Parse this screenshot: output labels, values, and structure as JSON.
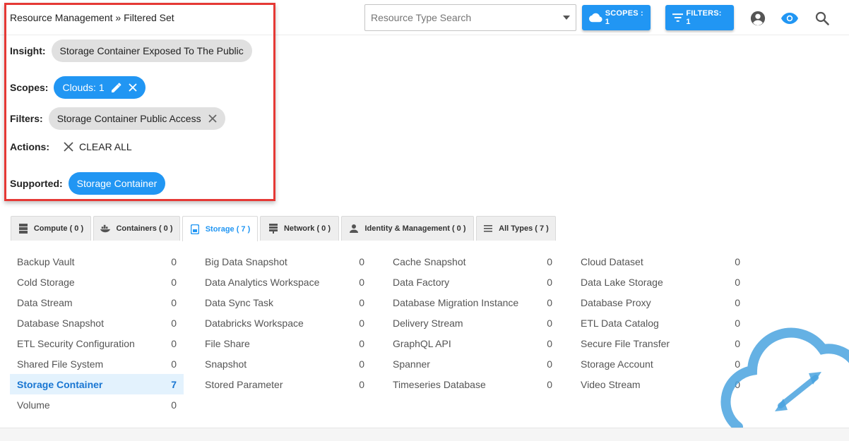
{
  "header": {
    "breadcrumb": "Resource Management » Filtered Set",
    "type_search_placeholder": "Resource Type Search",
    "scopes_button": "SCOPES : 1",
    "filters_button": "FILTERS: 1",
    "icons": [
      "account-circle-icon",
      "eye-icon",
      "search-icon"
    ]
  },
  "summary": {
    "insight_label": "Insight:",
    "insight_value": "Storage Container Exposed To The Public",
    "scopes_label": "Scopes:",
    "scopes_chip": "Clouds: 1",
    "filters_label": "Filters:",
    "filters_chip": "Storage Container Public Access",
    "actions_label": "Actions:",
    "clear_all": "CLEAR ALL",
    "supported_label": "Supported:",
    "supported_chip": "Storage Container"
  },
  "tabs": [
    {
      "label": "Compute ( 0 )",
      "icon": "server-icon"
    },
    {
      "label": "Containers ( 0 )",
      "icon": "docker-icon"
    },
    {
      "label": "Storage ( 7 )",
      "icon": "storage-icon",
      "active": true
    },
    {
      "label": "Network ( 0 )",
      "icon": "network-icon"
    },
    {
      "label": "Identity & Management ( 0 )",
      "icon": "person-icon"
    },
    {
      "label": "All Types ( 7 )",
      "icon": "list-icon"
    }
  ],
  "resource_types": [
    {
      "name": "Backup Vault",
      "count": "0"
    },
    {
      "name": "Big Data Snapshot",
      "count": "0"
    },
    {
      "name": "Cache Snapshot",
      "count": "0"
    },
    {
      "name": "Cloud Dataset",
      "count": "0"
    },
    {
      "name": "Cold Storage",
      "count": "0"
    },
    {
      "name": "Data Analytics Workspace",
      "count": "0"
    },
    {
      "name": "Data Factory",
      "count": "0"
    },
    {
      "name": "Data Lake Storage",
      "count": "0"
    },
    {
      "name": "Data Stream",
      "count": "0"
    },
    {
      "name": "Data Sync Task",
      "count": "0"
    },
    {
      "name": "Database Migration Instance",
      "count": "0"
    },
    {
      "name": "Database Proxy",
      "count": "0"
    },
    {
      "name": "Database Snapshot",
      "count": "0"
    },
    {
      "name": "Databricks Workspace",
      "count": "0"
    },
    {
      "name": "Delivery Stream",
      "count": "0"
    },
    {
      "name": "ETL Data Catalog",
      "count": "0"
    },
    {
      "name": "ETL Security Configuration",
      "count": "0"
    },
    {
      "name": "File Share",
      "count": "0"
    },
    {
      "name": "GraphQL API",
      "count": "0"
    },
    {
      "name": "Secure File Transfer",
      "count": "0"
    },
    {
      "name": "Shared File System",
      "count": "0"
    },
    {
      "name": "Snapshot",
      "count": "0"
    },
    {
      "name": "Spanner",
      "count": "0"
    },
    {
      "name": "Storage Account",
      "count": "0"
    },
    {
      "name": "Storage Container",
      "count": "7",
      "selected": true
    },
    {
      "name": "Stored Parameter",
      "count": "0"
    },
    {
      "name": "Timeseries Database",
      "count": "0"
    },
    {
      "name": "Video Stream",
      "count": "0"
    },
    {
      "name": "Volume",
      "count": "0"
    }
  ],
  "colors": {
    "accent": "#2196f3",
    "highlight_border": "#e53935",
    "chip_grey": "#e0e0e0"
  }
}
